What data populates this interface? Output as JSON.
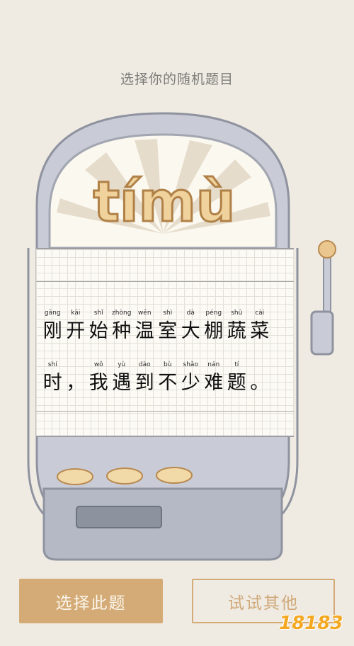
{
  "header": {
    "prompt": "选择你的随机题目"
  },
  "machine": {
    "logo": "tímù"
  },
  "question": {
    "line1": [
      {
        "py": "gāng",
        "hz": "刚"
      },
      {
        "py": "kāi",
        "hz": "开"
      },
      {
        "py": "shǐ",
        "hz": "始"
      },
      {
        "py": "zhòng",
        "hz": "种"
      },
      {
        "py": "wēn",
        "hz": "温"
      },
      {
        "py": "shì",
        "hz": "室"
      },
      {
        "py": "dà",
        "hz": "大"
      },
      {
        "py": "péng",
        "hz": "棚"
      },
      {
        "py": "shū",
        "hz": "蔬"
      },
      {
        "py": "cài",
        "hz": "菜"
      }
    ],
    "line2": [
      {
        "py": "shí",
        "hz": "时"
      },
      {
        "py": "",
        "hz": "，"
      },
      {
        "py": "wǒ",
        "hz": "我"
      },
      {
        "py": "yù",
        "hz": "遇"
      },
      {
        "py": "dào",
        "hz": "到"
      },
      {
        "py": "bù",
        "hz": "不"
      },
      {
        "py": "shǎo",
        "hz": "少"
      },
      {
        "py": "nán",
        "hz": "难"
      },
      {
        "py": "tí",
        "hz": "题"
      },
      {
        "py": "",
        "hz": "。"
      }
    ]
  },
  "buttons": {
    "choose": "选择此题",
    "other": "试试其他"
  },
  "watermark": "18183",
  "colors": {
    "background": "#efebe3",
    "accent": "#d4ab76",
    "machine": "#c9ccd6"
  }
}
